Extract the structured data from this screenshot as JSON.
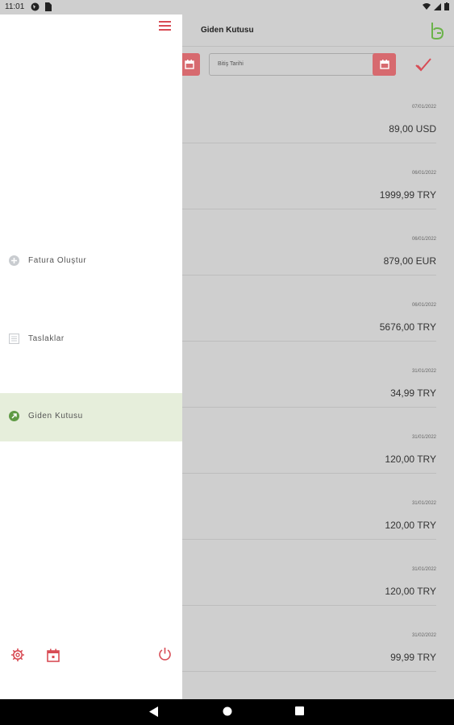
{
  "status_bar": {
    "time": "11:01"
  },
  "header": {
    "title": "Giden Kutusu"
  },
  "filter": {
    "end_date_placeholder": "Bitiş Tarihi"
  },
  "invoices": [
    {
      "date": "07/01/2022",
      "amount": "89,00 USD"
    },
    {
      "date": "06/01/2022",
      "amount": "1999,99 TRY"
    },
    {
      "date": "06/01/2022",
      "amount": "879,00 EUR"
    },
    {
      "date": "06/01/2022",
      "amount": "5676,00 TRY"
    },
    {
      "date": "31/01/2022",
      "amount": "34,99 TRY"
    },
    {
      "date": "31/01/2022",
      "amount": "120,00 TRY"
    },
    {
      "date": "31/01/2022",
      "amount": "120,00 TRY"
    },
    {
      "date": "31/01/2022",
      "amount": "120,00 TRY"
    },
    {
      "date": "31/02/2022",
      "amount": "99,99 TRY"
    }
  ],
  "drawer": {
    "items": [
      {
        "label": "Fatura Oluştur",
        "icon": "plus-circle-icon",
        "active": false
      },
      {
        "label": "Taslaklar",
        "icon": "document-icon",
        "active": false
      },
      {
        "label": "Giden Kutusu",
        "icon": "outbox-arrow-icon",
        "active": true
      }
    ]
  },
  "colors": {
    "accent": "#d84c55",
    "active_item_bg": "#e6eedb",
    "active_icon": "#5f9a45",
    "overlay": "#cfcfcf"
  }
}
